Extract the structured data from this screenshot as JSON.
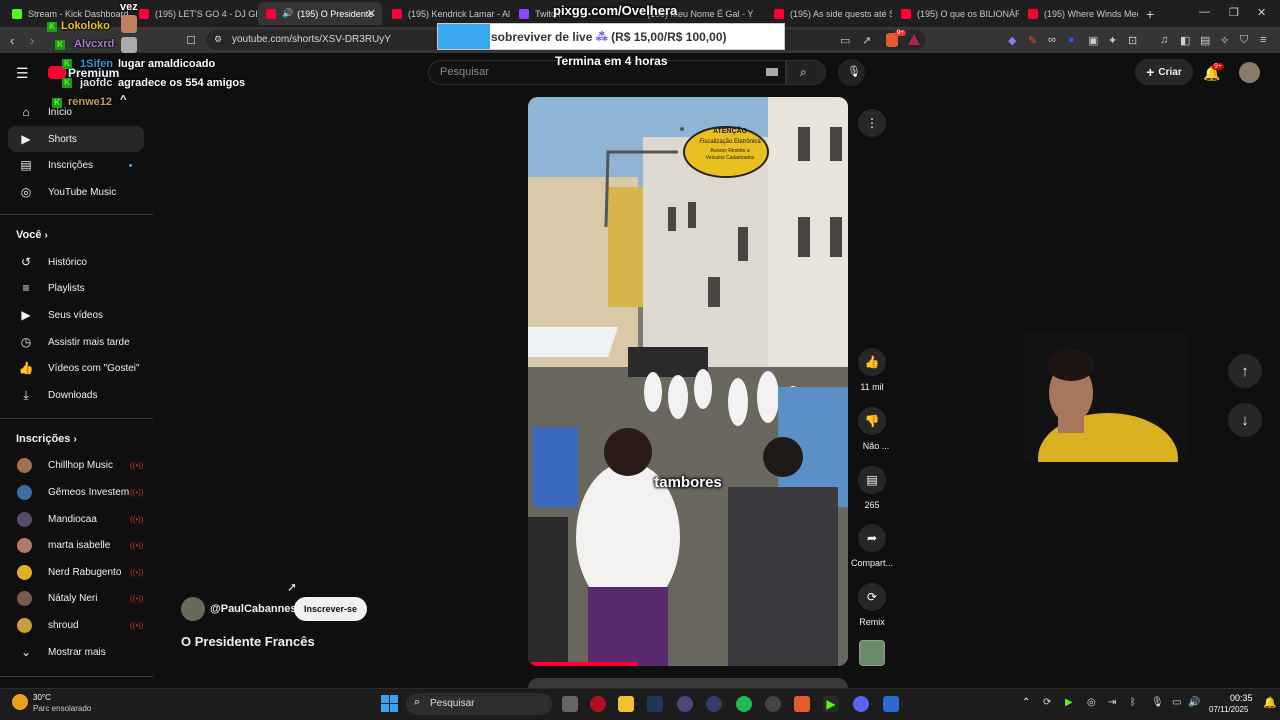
{
  "browser": {
    "tabs": [
      {
        "title": "Stream - Kick Dashboard",
        "favicon": "kick",
        "active": false
      },
      {
        "title": "(195) LET'S GO 4 - DJ GBR",
        "favicon": "youtube",
        "active": false
      },
      {
        "title": "(195) O Presidente",
        "favicon": "youtube",
        "active": true
      },
      {
        "title": "(195) Kendrick Lamar - Alr",
        "favicon": "youtube",
        "active": false
      },
      {
        "title": "Twitch",
        "favicon": "twitch",
        "active": false
      },
      {
        "title": "(195) Meu Nome É Gal - Y",
        "favicon": "youtube",
        "active": false
      },
      {
        "title": "(195) As side quests até S",
        "favicon": "youtube",
        "active": false
      },
      {
        "title": "(195) O que os BILIONÁRI",
        "favicon": "youtube",
        "active": false
      },
      {
        "title": "(195) Where Winds Meet",
        "favicon": "youtube",
        "active": false
      }
    ],
    "url": "youtube.com/shorts/XSV-DR3RUyY",
    "badge": "9+"
  },
  "youtube": {
    "logo_text": "Premium",
    "search_placeholder": "Pesquisar",
    "create_label": "Criar",
    "notif_count": "9+",
    "sidebar": {
      "main": [
        {
          "label": "Início",
          "icon": "home-icon"
        },
        {
          "label": "Shorts",
          "icon": "shorts-icon",
          "active": true
        },
        {
          "label": "Inscrições",
          "icon": "subscriptions-icon"
        },
        {
          "label": "YouTube Music",
          "icon": "music-icon"
        }
      ],
      "you_header": "Você",
      "you": [
        {
          "label": "Histórico",
          "icon": "history-icon"
        },
        {
          "label": "Playlists",
          "icon": "playlists-icon"
        },
        {
          "label": "Seus vídeos",
          "icon": "your-videos-icon"
        },
        {
          "label": "Assistir mais tarde",
          "icon": "watch-later-icon"
        },
        {
          "label": "Vídeos com \"Gostei\"",
          "icon": "liked-icon"
        },
        {
          "label": "Downloads",
          "icon": "download-icon"
        }
      ],
      "subs_header": "Inscrições",
      "subs": [
        {
          "label": "Chillhop Music",
          "color": "#a07050"
        },
        {
          "label": "Gêmeos Investem",
          "color": "#3a6ea5"
        },
        {
          "label": "Mandiocaa",
          "color": "#5a4a6a"
        },
        {
          "label": "marta isabelle",
          "color": "#b07a6a"
        },
        {
          "label": "Nerd Rabugento",
          "color": "#e0b020"
        },
        {
          "label": "Nátaly Neri",
          "color": "#7a5a4a"
        },
        {
          "label": "shroud",
          "color": "#c8a040"
        }
      ],
      "show_more": "Mostrar mais"
    },
    "short": {
      "channel": "@PaulCabannes",
      "subscribe": "Inscrever-se",
      "title": "O Presidente Francês",
      "caption": "tambores",
      "sign_line1": "ATENÇÃO",
      "sign_line2": "Fiscalização Eletrônica",
      "sign_line3": "Acesso Restrito a",
      "sign_line4": "Veículos Cadastrados",
      "likes": "11 mil",
      "dislike": "Não ...",
      "comments": "265",
      "share": "Compart...",
      "remix": "Remix"
    }
  },
  "stream_overlay": {
    "chat": [
      {
        "name": "vez",
        "color": "#ffffff"
      },
      {
        "name": "Lokoloko",
        "color": "#f1c40f"
      },
      {
        "name": "Alvcxrd",
        "color": "#9b59b6"
      },
      {
        "name": "1Sifen",
        "color": "#3498db"
      },
      {
        "name": "jaofdc",
        "color": "#e0e0e0"
      },
      {
        "name": "renwe12",
        "color": "#c0a060"
      }
    ],
    "msg1": "lugar amaldicoado",
    "msg2": "agradece os 554 amigos",
    "pix_title": "pixgg.com/Ovelhera",
    "pix_goal": "sobreviver de live",
    "pix_amount": "(R$ 15,00/R$ 100,00)",
    "pix_timer": "Termina em 4 horas",
    "pix_progress": 0.15
  },
  "taskbar": {
    "weather_temp": "30°C",
    "weather_desc": "Parc ensolarado",
    "search": "Pesquisar",
    "time": "00:35",
    "date": "07/11/2025"
  }
}
